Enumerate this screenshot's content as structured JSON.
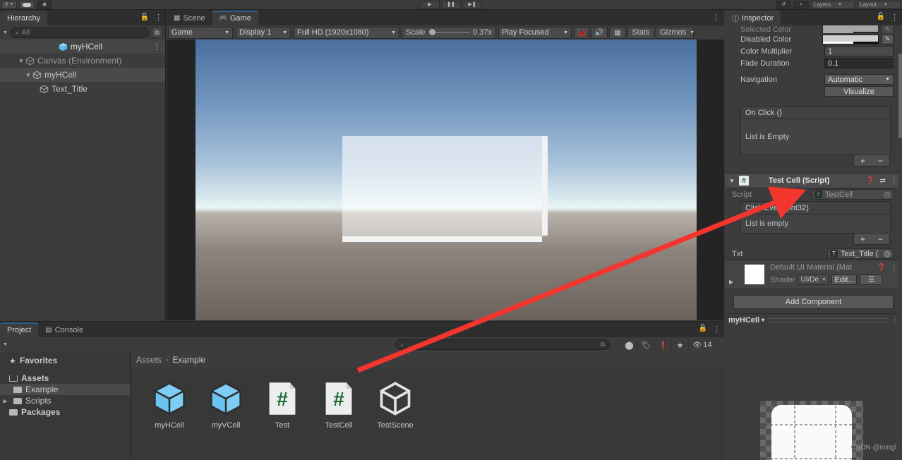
{
  "toolbar": {
    "left_buttons": [
      "account-dropdown",
      "cloud-button",
      "collab-button"
    ],
    "account_label": "3",
    "playback": [
      "play-icon",
      "pause-icon",
      "step-icon"
    ],
    "undo_icon": "↺",
    "search_icon": "🔍",
    "layers_label": "Layers",
    "layout_label": "Layout"
  },
  "hierarchy": {
    "tab_label": "Hierarchy",
    "lock_icon": "lock-icon",
    "menu_icon": "⋮",
    "search_placeholder": "All",
    "search_icon": "search-icon",
    "scene_name": "myHCell",
    "rows": [
      {
        "label": "Canvas (Environment)",
        "indent": 1,
        "expanded": true,
        "dim": true
      },
      {
        "label": "myHCell",
        "indent": 2,
        "expanded": true,
        "dim": false,
        "selected": true
      },
      {
        "label": "Text_Title",
        "indent": 3,
        "expanded": false,
        "dim": false
      }
    ]
  },
  "gameview": {
    "tabs": [
      {
        "label": "Scene",
        "icon": "grid-icon",
        "active": false
      },
      {
        "label": "Game",
        "icon": "gamepad-icon",
        "active": true
      }
    ],
    "menu_icon": "⋮",
    "target_display": "Game",
    "display": "Display 1",
    "resolution": "Full HD (1920x1080)",
    "scale_label": "Scale",
    "scale_value": "0.37x",
    "play_mode": "Play Focused",
    "mute_icon": "speaker-icon",
    "bug_icon": "bug-icon",
    "aspect_icon": "keyboard-icon",
    "stats_label": "Stats",
    "gizmos_label": "Gizmos"
  },
  "project": {
    "tabs": [
      {
        "label": "Project",
        "icon": "",
        "active": true
      },
      {
        "label": "Console",
        "icon": "console-icon",
        "active": false
      }
    ],
    "lock_icon": "lock-icon",
    "menu_icon": "⋮",
    "search_placeholder": "",
    "search_icon": "search-icon",
    "filters": [
      "object-filter-icon",
      "label-filter-icon",
      "warning-filter-icon",
      "star-filter-icon"
    ],
    "hidden_count": "14",
    "hidden_icon": "eye-off-icon",
    "tree": [
      {
        "label": "Favorites",
        "icon": "star-icon",
        "indent": 0,
        "bold": true,
        "arrow": ""
      },
      {
        "label": "Assets",
        "icon": "folder-open-icon",
        "indent": 0,
        "bold": true,
        "arrow": ""
      },
      {
        "label": "Example",
        "icon": "folder-icon",
        "indent": 1,
        "bold": false,
        "arrow": "",
        "selected": true
      },
      {
        "label": "Scripts",
        "icon": "folder-icon",
        "indent": 1,
        "bold": false,
        "arrow": "▶"
      },
      {
        "label": "Packages",
        "icon": "folder-icon",
        "indent": 0,
        "bold": true,
        "arrow": ""
      }
    ],
    "breadcrumb": [
      "Assets",
      "Example"
    ],
    "breadcrumb_sep": "›",
    "assets": [
      {
        "label": "myHCell",
        "icon": "prefab-icon"
      },
      {
        "label": "myVCell",
        "icon": "prefab-icon"
      },
      {
        "label": "Test",
        "icon": "csharp-script-icon"
      },
      {
        "label": "TestCell",
        "icon": "csharp-script-icon"
      },
      {
        "label": "TestScene",
        "icon": "unity-scene-icon"
      }
    ]
  },
  "inspector": {
    "tab_label": "Inspector",
    "tab_icon": "info-icon",
    "lock_icon": "lock-icon",
    "menu_icon": "⋮",
    "cut_row_label": "Selected Color",
    "properties": [
      {
        "label": "Disabled Color",
        "type": "color"
      },
      {
        "label": "Color Multiplier",
        "type": "number",
        "value": "1"
      },
      {
        "label": "Fade Duration",
        "type": "number",
        "value": "0.1"
      }
    ],
    "navigation_label": "Navigation",
    "navigation_value": "Automatic",
    "visualize_label": "Visualize",
    "on_click": {
      "title": "On Click ()",
      "empty_text": "List is Empty",
      "add_label": "+",
      "remove_label": "−"
    },
    "script_component": {
      "title": "Test Cell (Script)",
      "icon": "csharp-icon",
      "help_icon": "?",
      "preset_icon": "preset-icon",
      "menu_icon": "⋮",
      "script_label": "Script",
      "script_value": "TestCell",
      "picker_icon": "◎"
    },
    "click_event": {
      "title": "Click Event (Int32)",
      "empty_text": "List is empty",
      "add_label": "+",
      "remove_label": "−"
    },
    "txt_field": {
      "label": "Txt",
      "value": "Text_Title (",
      "picker_icon": "◎"
    },
    "material": {
      "name": "Default UI Material (Mat",
      "help_icon": "?",
      "menu_icon": "⋮",
      "shader_label": "Shader",
      "shader_value": "UI/De",
      "edit_label": "Edit...",
      "extra_icon": "shader-menu-icon"
    },
    "add_component_label": "Add Component",
    "preview": {
      "object_name": "myHCell",
      "dropdown_icon": "▾",
      "menu_icon": "⋮",
      "watermark": "CSDN @iningl"
    }
  },
  "colors": {
    "panel_bg": "#3c3c3c",
    "panel_dark": "#2e2e2e",
    "selection": "#4a4a4a",
    "accent_blue": "#2c5d87",
    "prefab_blue": "#6ec6f0",
    "script_green": "#1f6b35",
    "arrow_red": "#f4352e"
  }
}
